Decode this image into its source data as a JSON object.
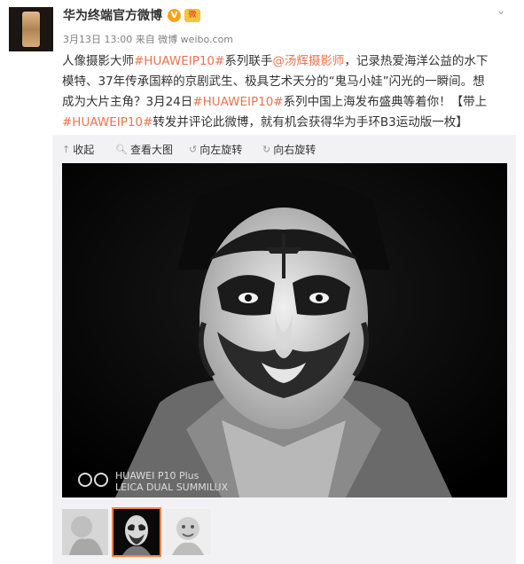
{
  "post": {
    "username": "华为终端官方微博",
    "verified_mark": "V",
    "badge_label": "微",
    "meta": "3月13日 13:00 来自 微博 weibo.com",
    "text_lines": [
      {
        "before": "人像摄影大师",
        "tag1": "#HUAWEIP10#",
        "mid": "系列联手",
        "mention": "@汤辉摄影师",
        "after": "，记录热爱海洋公益的水下"
      },
      {
        "text": "模特、37年传承国粹的京剧武生、极具艺术天分的“鬼马小娃”闪光的一瞬间。想"
      },
      {
        "before": "成为大片主角？3月24日",
        "tag1": "#HUAWEIP10#",
        "after": "系列中国上海发布盛典等着你！【带上"
      },
      {
        "tag1": "#HUAWEIP10#",
        "after": "转发并评论此微博，就有机会获得华为手环B3运动版一枚】"
      }
    ]
  },
  "toolbar": {
    "collapse": "收起",
    "view_large": "查看大图",
    "rotate_left": "向左旋转",
    "rotate_right": "向右旋转"
  },
  "photo": {
    "watermark_line1": "HUAWEI P10 Plus",
    "watermark_line2": "LEICA DUAL SUMMILUX"
  },
  "colors": {
    "link": "#eb7350",
    "thumb_active_border": "#ff8140"
  },
  "icons": {
    "collapse": "arrow-up-icon",
    "view_large": "magnifier-icon",
    "rotate_left": "rotate-left-icon",
    "rotate_right": "rotate-right-icon",
    "menu": "chevron-down-icon"
  }
}
